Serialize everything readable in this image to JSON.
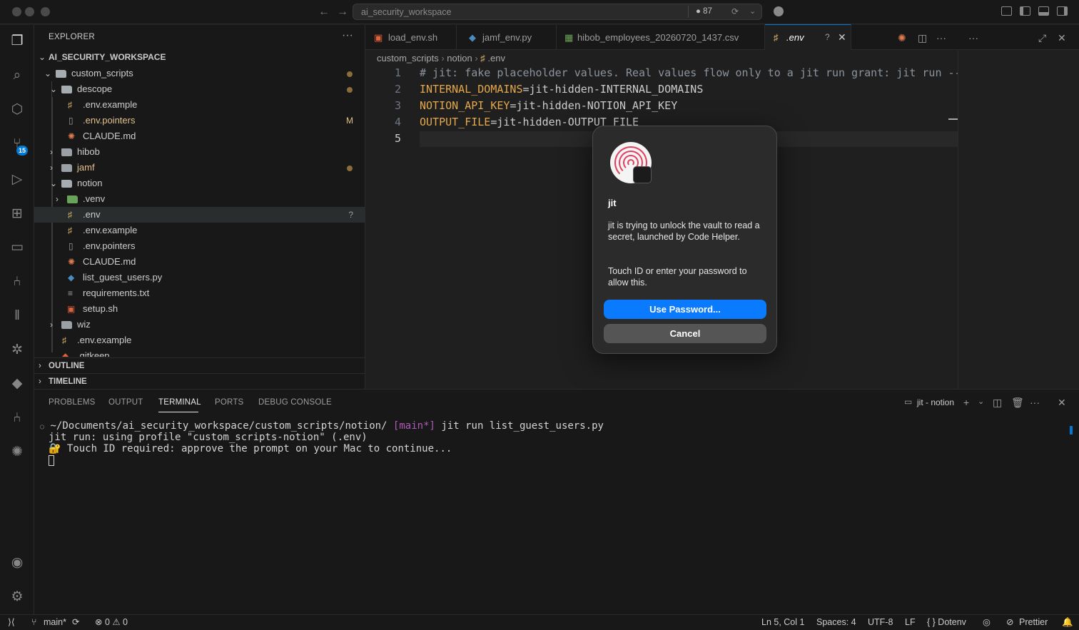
{
  "titlebar": {
    "search_text": "ai_security_workspace",
    "badge": "● 87"
  },
  "activity": {
    "scm_badge": "15"
  },
  "explorer": {
    "title": "EXPLORER",
    "workspace": "AI_SECURITY_WORKSPACE",
    "items": [
      {
        "label": "custom_scripts",
        "type": "folder"
      },
      {
        "label": "descope",
        "type": "folder"
      },
      {
        "label": ".env.example",
        "type": "env"
      },
      {
        "label": ".env.pointers",
        "type": "file",
        "decoration": "M"
      },
      {
        "label": "CLAUDE.md",
        "type": "claude"
      },
      {
        "label": "hibob",
        "type": "folder"
      },
      {
        "label": "jamf",
        "type": "folder"
      },
      {
        "label": "notion",
        "type": "folder"
      },
      {
        "label": ".venv",
        "type": "folder"
      },
      {
        "label": ".env",
        "type": "env",
        "decoration": "?"
      },
      {
        "label": ".env.example",
        "type": "env"
      },
      {
        "label": ".env.pointers",
        "type": "file"
      },
      {
        "label": "CLAUDE.md",
        "type": "claude"
      },
      {
        "label": "list_guest_users.py",
        "type": "python"
      },
      {
        "label": "requirements.txt",
        "type": "text"
      },
      {
        "label": "setup.sh",
        "type": "shell"
      },
      {
        "label": "wiz",
        "type": "folder"
      },
      {
        "label": ".env.example",
        "type": "env"
      },
      {
        "label": ".gitkeep",
        "type": "git"
      }
    ],
    "outline": "OUTLINE",
    "timeline": "TIMELINE"
  },
  "tabs": [
    {
      "label": "load_env.sh"
    },
    {
      "label": "jamf_env.py"
    },
    {
      "label": "hibob_employees_20260720_1437.csv"
    },
    {
      "label": ".env",
      "status": "?"
    }
  ],
  "breadcrumb": {
    "p1": "custom_scripts",
    "p2": "notion",
    "p3": ".env"
  },
  "editor": {
    "lines": [
      {
        "n": "1",
        "comment": "# jit: fake placeholder values. Real values flow only to a jit run grant: jit run --"
      },
      {
        "n": "2",
        "key": "INTERNAL_DOMAINS",
        "value": "=jit-hidden-INTERNAL_DOMAINS"
      },
      {
        "n": "3",
        "key": "NOTION_API_KEY",
        "value": "=jit-hidden-NOTION_API_KEY"
      },
      {
        "n": "4",
        "key": "OUTPUT_FILE",
        "value": "=jit-hidden-OUTPUT_FILE"
      },
      {
        "n": "5"
      }
    ]
  },
  "dialog": {
    "title": "jit",
    "message": "jit is trying to unlock the vault to read a secret, launched by Code Helper.",
    "instruction": "Touch ID or enter your password to allow this.",
    "primary_button": "Use Password...",
    "cancel_button": "Cancel"
  },
  "panel": {
    "tabs": [
      "PROBLEMS",
      "OUTPUT",
      "TERMINAL",
      "PORTS",
      "DEBUG CONSOLE"
    ],
    "active_tab": "TERMINAL",
    "terminal_name": "jit - notion",
    "terminal": {
      "prompt_path": "~/Documents/ai_security_workspace/custom_scripts/notion/",
      "branch": "[main*]",
      "command": "jit run list_guest_users.py",
      "line2": "jit run: using profile \"custom_scripts-notion\" (.env)",
      "line3": "🔐 Touch ID required: approve the prompt on your Mac to continue..."
    }
  },
  "statusbar": {
    "branch": "main*",
    "problems": "⊗ 0 ⚠ 0",
    "position": "Ln 5, Col 1",
    "spaces": "Spaces: 4",
    "encoding": "UTF-8",
    "eol": "LF",
    "language": "{ } Dotenv",
    "prettier": "Prettier"
  }
}
